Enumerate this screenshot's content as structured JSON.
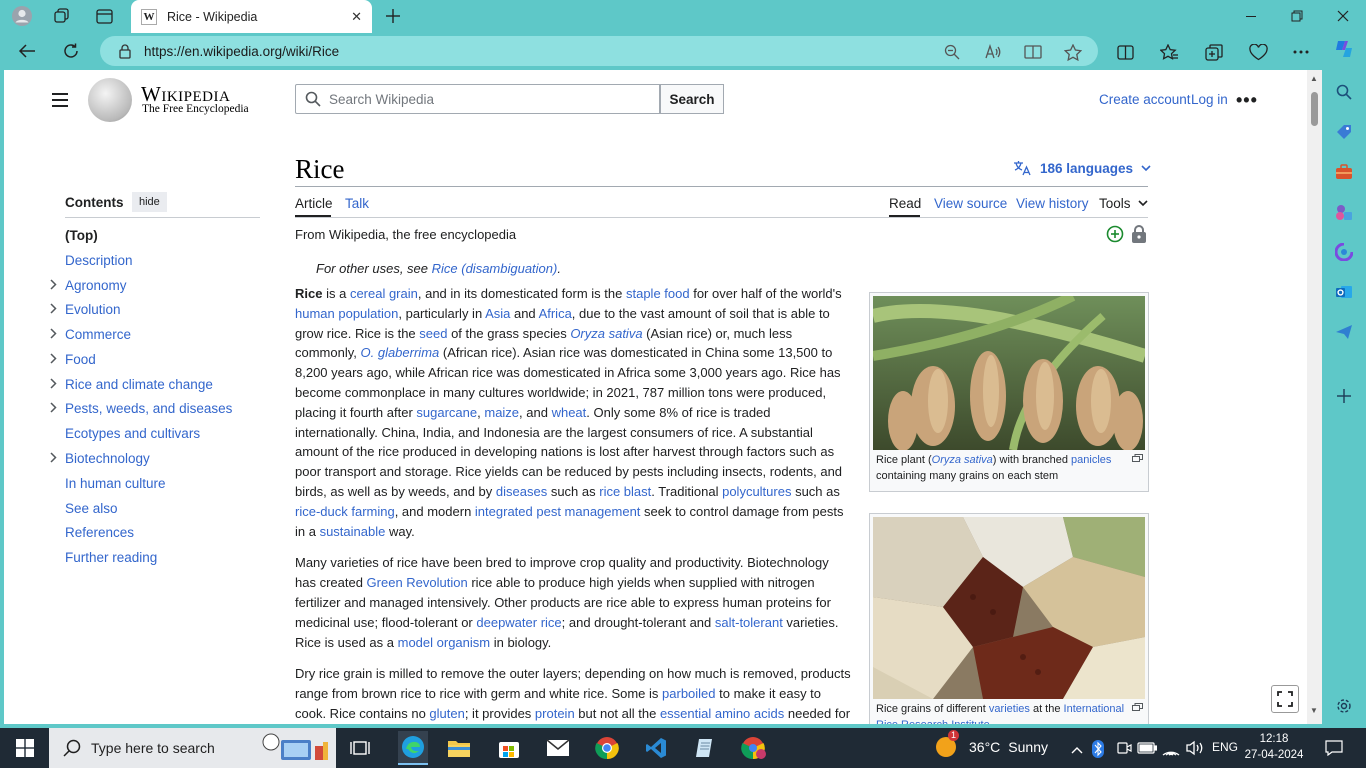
{
  "browser": {
    "tab_title": "Rice - Wikipedia",
    "tab_favicon": "W",
    "url": "https://en.wikipedia.org/wiki/Rice",
    "accent": "#5ec8c8"
  },
  "wiki_header": {
    "wordmark": "Wikipedia",
    "tagline": "The Free Encyclopedia",
    "search_placeholder": "Search Wikipedia",
    "search_button": "Search",
    "create_account": "Create account",
    "log_in": "Log in",
    "more": "•••"
  },
  "toc": {
    "heading": "Contents",
    "hide": "hide",
    "items": [
      {
        "label": "(Top)",
        "expandable": false
      },
      {
        "label": "Description",
        "expandable": false
      },
      {
        "label": "Agronomy",
        "expandable": true
      },
      {
        "label": "Evolution",
        "expandable": true
      },
      {
        "label": "Commerce",
        "expandable": true
      },
      {
        "label": "Food",
        "expandable": true
      },
      {
        "label": "Rice and climate change",
        "expandable": true
      },
      {
        "label": "Pests, weeds, and diseases",
        "expandable": true
      },
      {
        "label": "Ecotypes and cultivars",
        "expandable": false
      },
      {
        "label": "Biotechnology",
        "expandable": true
      },
      {
        "label": "In human culture",
        "expandable": false
      },
      {
        "label": "See also",
        "expandable": false
      },
      {
        "label": "References",
        "expandable": false
      },
      {
        "label": "Further reading",
        "expandable": false
      }
    ]
  },
  "article": {
    "title": "Rice",
    "languages": "186 languages",
    "tabs_left": [
      "Article",
      "Talk"
    ],
    "tabs_right": [
      "Read",
      "View source",
      "View history",
      "Tools"
    ],
    "from": "From Wikipedia, the free encyclopedia",
    "hatnote_prefix": "For other uses, see ",
    "hatnote_link": "Rice (disambiguation)",
    "hatnote_suffix": "."
  },
  "figures": [
    {
      "cap_a": "Rice plant (",
      "cap_link1": "Oryza sativa",
      "cap_b": ") with branched ",
      "cap_link2": "panicles",
      "cap_c": " containing many grains on each stem"
    },
    {
      "cap_a": "Rice grains of different ",
      "cap_link1": "varieties",
      "cap_b": " at the ",
      "cap_link2": "International Rice Research Institute",
      "cap_c": ""
    }
  ],
  "taskbar": {
    "search_placeholder": "Type here to search",
    "weather_temp": "36°C",
    "weather_cond": "Sunny",
    "weather_badge": "1",
    "lang": "ENG",
    "time": "12:18",
    "date": "27-04-2024"
  }
}
